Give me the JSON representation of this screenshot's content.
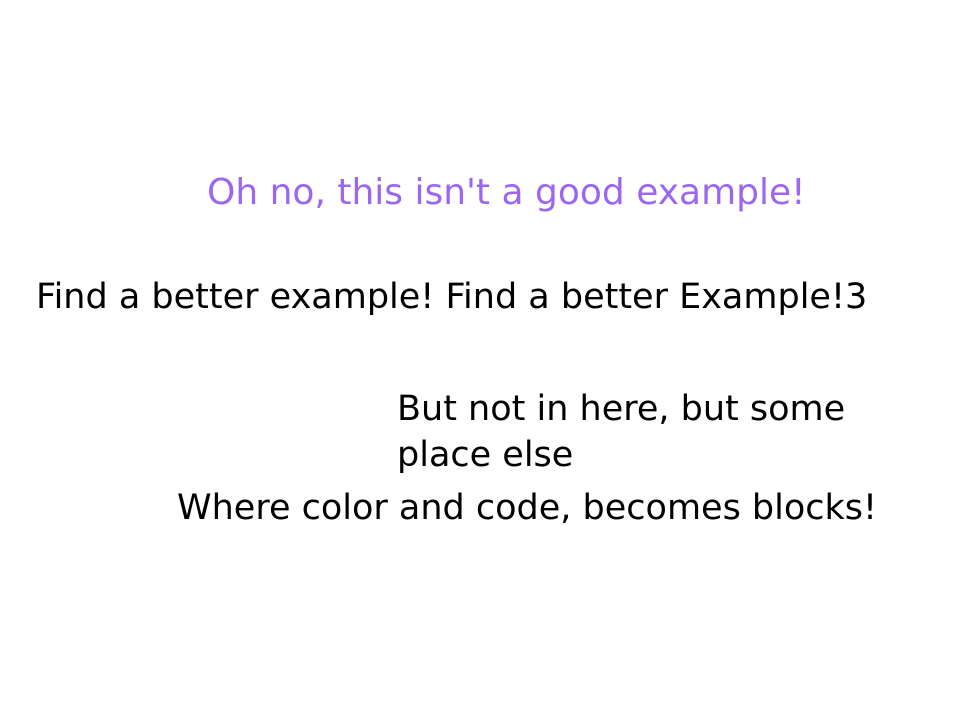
{
  "colors": {
    "headline": "#9b67f0",
    "text": "#000000",
    "background": "#ffffff"
  },
  "content": {
    "headline": "Oh no, this isn't a good example!",
    "find_better": "Find a better example! Find a better Example!3",
    "not_here": "But not in here, but some place else",
    "where": "Where color and code, becomes blocks!"
  }
}
